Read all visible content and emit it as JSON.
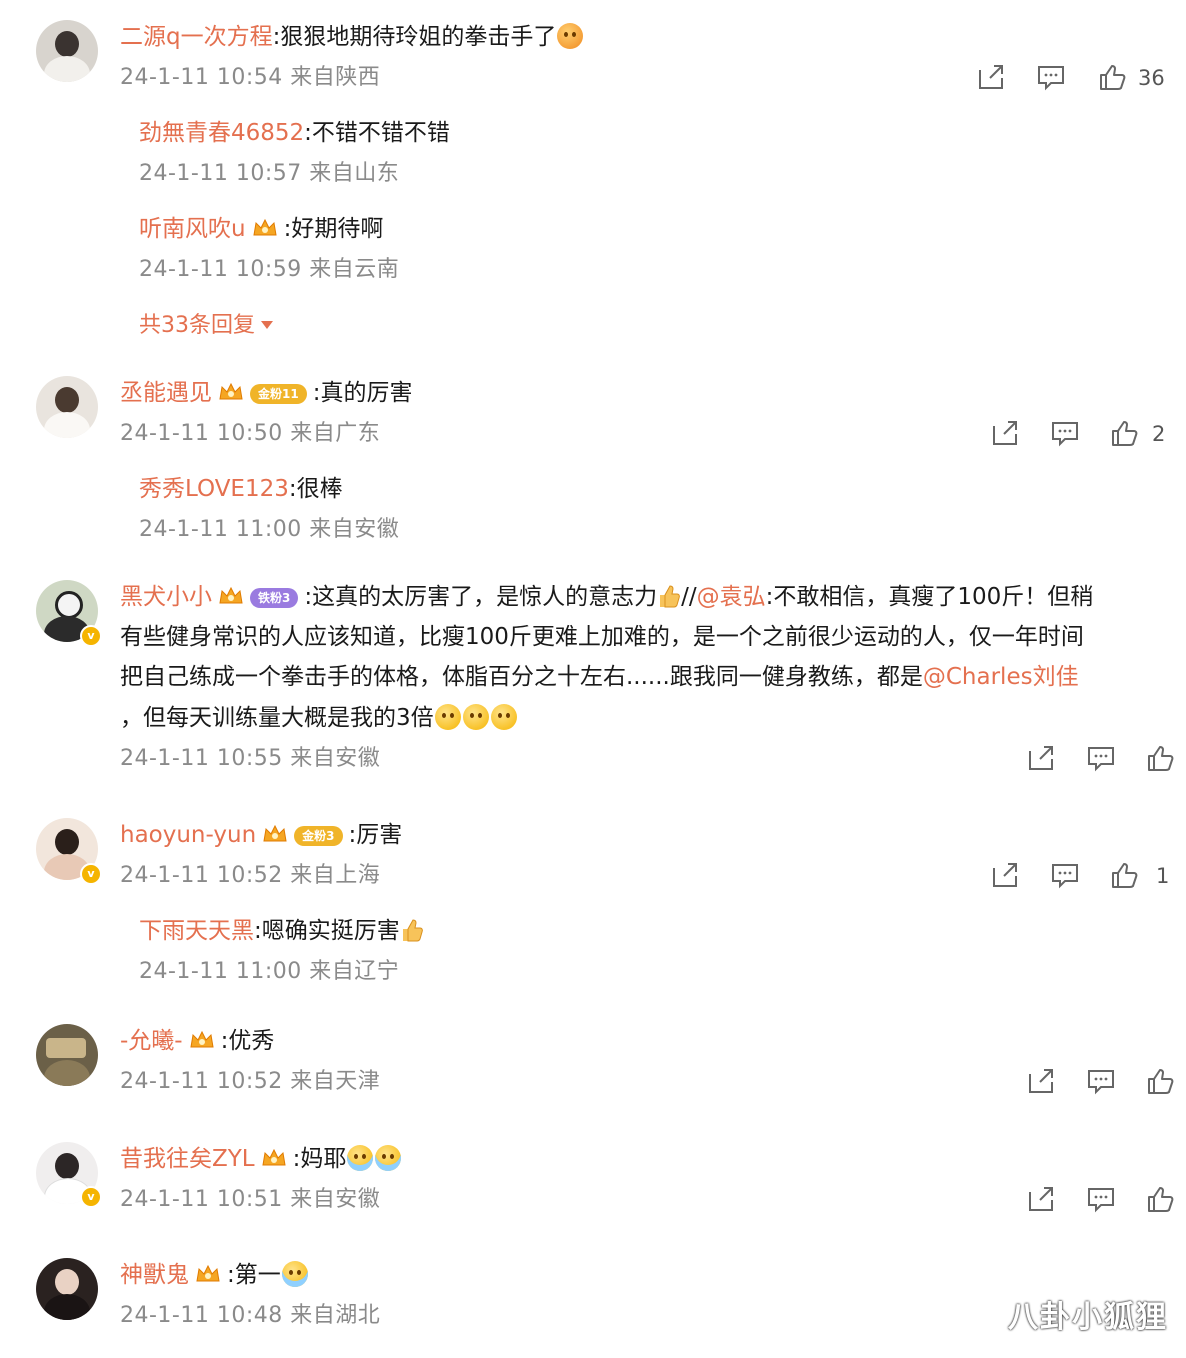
{
  "colors": {
    "username": "#e4704f",
    "meta": "#8a8a8a",
    "text": "#1a1a1a",
    "badge": "#f5b400"
  },
  "comments": [
    {
      "user": "二源q一次方程",
      "text": ":狠狠地期待玲姐的拳击手了",
      "meta": "24-1-11 10:54 来自陕西",
      "likes": "36",
      "replies": [
        {
          "user": "劲無青春46852",
          "text": ":不错不错不错",
          "meta": "24-1-11 10:57 来自山东"
        },
        {
          "user": "听南风吹u",
          "text": ":好期待啊",
          "meta": "24-1-11 10:59 来自云南"
        }
      ],
      "more_replies": "共33条回复"
    },
    {
      "user": "丞能遇见",
      "level": "金粉11",
      "text": ":真的厉害",
      "meta": "24-1-11 10:50 来自广东",
      "likes": "2",
      "replies": [
        {
          "user": "秀秀LOVE123",
          "text": ":很棒",
          "meta": "24-1-11 11:00 来自安徽"
        }
      ]
    },
    {
      "user": "黑犬小小",
      "level": "铁粉3",
      "text_l1": ":这真的太厉害了，是惊人的意志力",
      "text_l1b": "//",
      "mention1": "@袁弘",
      "text_l1c": ":不敢相信，真瘦了100斤！但稍",
      "text_l2": "有些健身常识的人应该知道，比瘦100斤更难上加难的，是一个之前很少运动的人，仅一年时间",
      "text_l3": "把自己练成一个拳击手的体格，体脂百分之十左右......跟我同一健身教练，都是",
      "mention2": "@Charles刘佳",
      "text_l4": "，但每天训练量大概是我的3倍",
      "meta": "24-1-11 10:55 来自安徽"
    },
    {
      "user": "haoyun-yun",
      "level": "金粉3",
      "text": ":厉害",
      "meta": "24-1-11 10:52 来自上海",
      "likes": "1",
      "replies": [
        {
          "user": "下雨天天黑",
          "text": ":嗯确实挺厉害",
          "meta": "24-1-11 11:00 来自辽宁"
        }
      ]
    },
    {
      "user": "-允曦-",
      "text": ":优秀",
      "meta": "24-1-11 10:52 来自天津"
    },
    {
      "user": "昔我往矣ZYL",
      "text": ":妈耶",
      "meta": "24-1-11 10:51 来自安徽"
    },
    {
      "user": "神獸鬼",
      "text": ":第一",
      "meta": "24-1-11 10:48 来自湖北"
    }
  ],
  "icons": {
    "share": "share-icon",
    "comment": "comment-icon",
    "like": "thumbs-up-icon",
    "crown": "crown-badge-icon",
    "verified": "verified-badge-icon"
  },
  "watermark": "八卦小狐狸"
}
